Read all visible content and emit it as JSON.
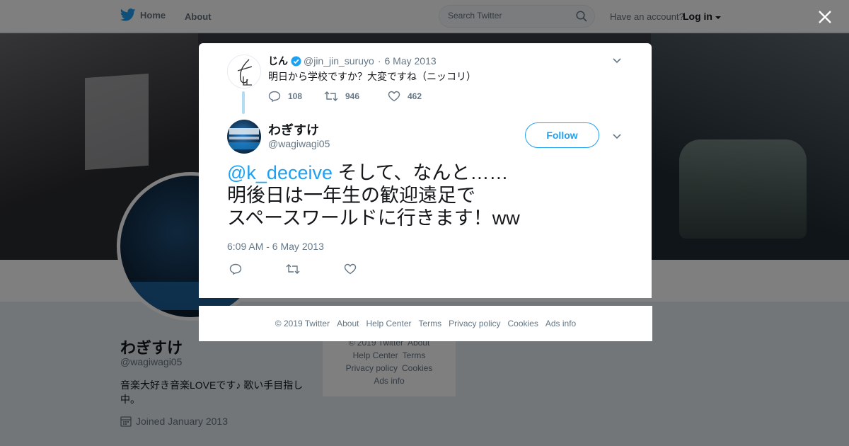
{
  "topbar": {
    "home_label": "Home",
    "about_label": "About",
    "search_placeholder": "Search Twitter",
    "have_account": "Have an account?",
    "login_label": "Log in"
  },
  "profile": {
    "name": "わぎすけ",
    "handle": "@wagiwagi05",
    "bio": "音楽大好き音楽LOVEです♪ 歌い手目指し中。",
    "joined": "Joined January 2013"
  },
  "side_footer": {
    "copyright": "© 2019 Twitter",
    "about": "About",
    "help": "Help Center",
    "terms": "Terms",
    "privacy": "Privacy policy",
    "cookies": "Cookies",
    "ads": "Ads info"
  },
  "context_tweet": {
    "name": "じん",
    "handle": "@jin_jin_suruyo",
    "separator": "·",
    "date": "6 May 2013",
    "text": "明日から学校ですか？大変ですね（ニッコリ）",
    "reply_count": "108",
    "retweet_count": "946",
    "like_count": "462"
  },
  "main_tweet": {
    "name": "わぎすけ",
    "handle": "@wagiwagi05",
    "follow_label": "Follow",
    "mention": "@k_deceive",
    "text_line1": " そして、なんと……",
    "text_line2": "明後日は一年生の歓迎遠足で",
    "text_line3": "スペースワールドに行きます！ww",
    "timestamp": "6:09 AM - 6 May 2013"
  },
  "modal_footer": {
    "copyright": "© 2019 Twitter",
    "about": "About",
    "help": "Help Center",
    "terms": "Terms",
    "privacy": "Privacy policy",
    "cookies": "Cookies",
    "ads": "Ads info"
  },
  "colors": {
    "accent": "#1da1f2",
    "text_primary": "#14171a",
    "text_secondary": "#657786",
    "overlay": "rgba(0,0,0,0.5)"
  },
  "icons": [
    "twitter-bird-icon",
    "search-icon",
    "close-icon",
    "verified-icon",
    "reply-icon",
    "retweet-icon",
    "like-icon",
    "caret-down-icon",
    "calendar-icon"
  ]
}
